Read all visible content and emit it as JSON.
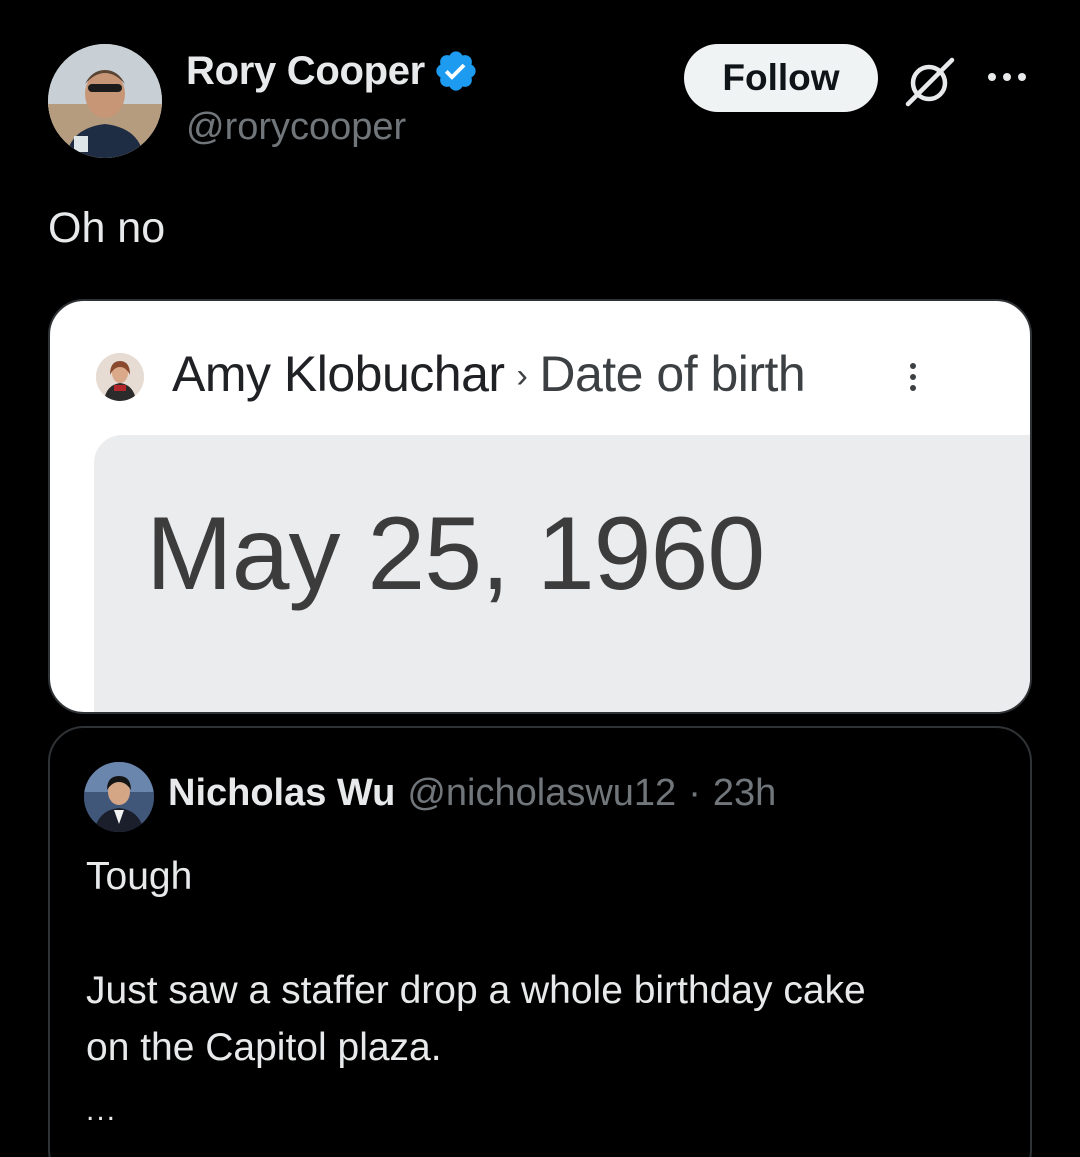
{
  "author": {
    "name": "Rory Cooper",
    "handle": "@rorycooper",
    "verified": true,
    "verified_color": "#1d9bf0"
  },
  "header": {
    "follow_label": "Follow",
    "grok_icon": "grok-slash-icon",
    "more_icon": "more-horizontal-icon"
  },
  "tweet": {
    "text": "Oh no"
  },
  "media": {
    "entity": "Amy Klobuchar",
    "separator": "›",
    "field": "Date of birth",
    "answer": "May 25, 1960",
    "menu_icon": "vertical-dots-icon"
  },
  "quote": {
    "name": "Nicholas Wu",
    "handle": "@nicholaswu12",
    "dot": "·",
    "time": "23h",
    "line1": "Tough",
    "line2": "Just saw a staffer drop a whole birthday cake",
    "line3": "on the Capitol plaza.",
    "ellipsis": "..."
  }
}
